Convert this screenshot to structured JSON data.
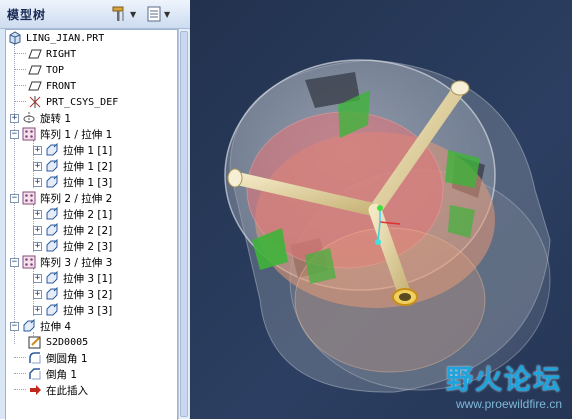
{
  "panel": {
    "title": "模型树",
    "tools_icon": "hammer-wrench-icon",
    "settings_icon": "list-settings-icon"
  },
  "tree": {
    "root": "LING_JIAN.PRT",
    "right": "RIGHT",
    "top": "TOP",
    "front": "FRONT",
    "csys": "PRT_CSYS_DEF",
    "revolve": "旋转 1",
    "pattern1": "阵列 1 / 拉伸 1",
    "p1_1": "拉伸 1 [1]",
    "p1_2": "拉伸 1 [2]",
    "p1_3": "拉伸 1 [3]",
    "pattern2": "阵列 2 / 拉伸 2",
    "p2_1": "拉伸 2 [1]",
    "p2_2": "拉伸 2 [2]",
    "p2_3": "拉伸 2 [3]",
    "pattern3": "阵列 3 / 拉伸 3",
    "p3_1": "拉伸 3 [1]",
    "p3_2": "拉伸 3 [2]",
    "p3_3": "拉伸 3 [3]",
    "extrude4": "拉伸 4",
    "sketch": "S2D0005",
    "round": "倒圆角 1",
    "chamfer": "倒角 1",
    "insert_here": "在此插入"
  },
  "watermark": {
    "title": "野火论坛",
    "url": "www.proewildfire.cn"
  },
  "colors": {
    "viewport_bg": "#2a3b5c",
    "arm": "#e8d9a5",
    "fin": "#3fb43a",
    "inner_disc": "#e08f8a",
    "watermark": "#1fa3dc"
  }
}
